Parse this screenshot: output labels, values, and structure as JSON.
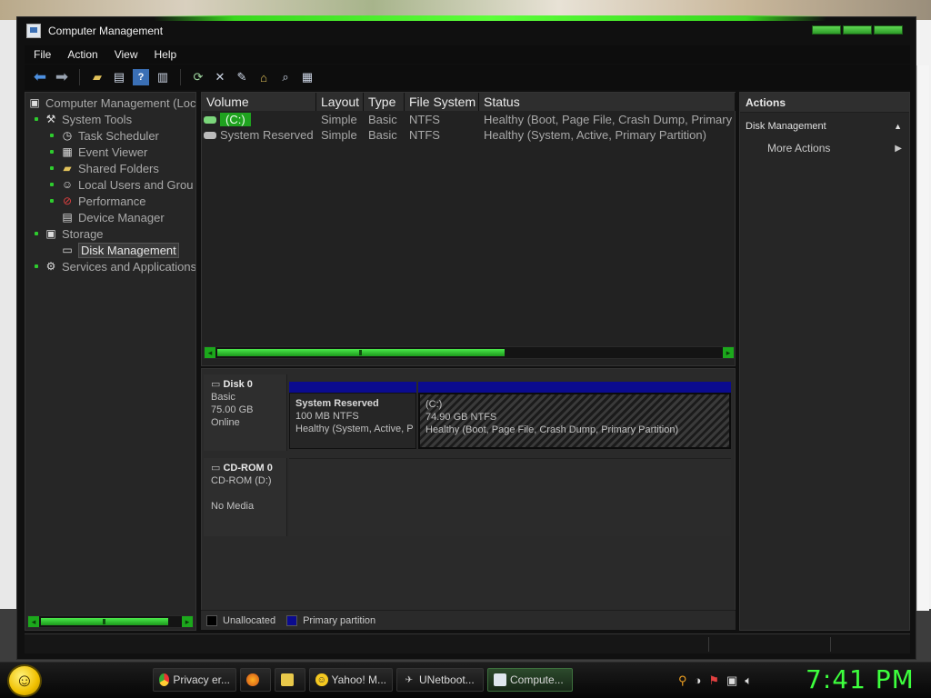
{
  "window": {
    "title": "Computer Management"
  },
  "menu": [
    "File",
    "Action",
    "View",
    "Help"
  ],
  "toolbar": [
    "back-icon",
    "forward-icon",
    "folder-up-icon",
    "properties-icon",
    "help-icon",
    "console-tree-icon",
    "refresh-icon",
    "delete-icon",
    "edit-icon",
    "open-icon",
    "search-icon",
    "settings-icon"
  ],
  "tree": {
    "root": "Computer Management (Loc",
    "system_tools": "System Tools",
    "task_scheduler": "Task Scheduler",
    "event_viewer": "Event Viewer",
    "shared_folders": "Shared Folders",
    "local_users": "Local Users and Grou",
    "performance": "Performance",
    "device_manager": "Device Manager",
    "storage": "Storage",
    "disk_management": "Disk Management",
    "services": "Services and Applications"
  },
  "volumes": {
    "headers": [
      "Volume",
      "Layout",
      "Type",
      "File System",
      "Status"
    ],
    "rows": [
      {
        "volume": "(C:)",
        "layout": "Simple",
        "type": "Basic",
        "fs": "NTFS",
        "status": "Healthy (Boot, Page File, Crash Dump, Primary"
      },
      {
        "volume": "System Reserved",
        "layout": "Simple",
        "type": "Basic",
        "fs": "NTFS",
        "status": "Healthy (System, Active, Primary Partition)"
      }
    ]
  },
  "disks": {
    "disk0": {
      "name": "Disk 0",
      "type": "Basic",
      "size": "75.00 GB",
      "state": "Online"
    },
    "cdrom0": {
      "name": "CD-ROM 0",
      "type": "CD-ROM (D:)",
      "state": "No Media"
    },
    "partitions": [
      {
        "name": "System Reserved",
        "size": "100 MB NTFS",
        "status": "Healthy (System, Active, P"
      },
      {
        "name": "(C:)",
        "size": "74.90 GB NTFS",
        "status": "Healthy (Boot, Page File, Crash Dump, Primary Partition)"
      }
    ]
  },
  "legend": {
    "unallocated": "Unallocated",
    "primary": "Primary partition",
    "unallocated_color": "#000000",
    "primary_color": "#0b0b8f"
  },
  "actions": {
    "header": "Actions",
    "section": "Disk Management",
    "more": "More Actions"
  },
  "taskbar": {
    "tasks": [
      {
        "label": "Privacy er...",
        "icon": "chrome-icon"
      },
      {
        "label": "",
        "icon": "firefox-icon"
      },
      {
        "label": "",
        "icon": "folder-icon"
      },
      {
        "label": "Yahoo! M...",
        "icon": "yahoo-messenger-icon"
      },
      {
        "label": "UNetboot...",
        "icon": "unetbootin-icon"
      },
      {
        "label": "Compute...",
        "icon": "computer-management-icon"
      }
    ],
    "clock": "7:41 PM"
  },
  "colors": {
    "accent": "#2ecc2e",
    "clock": "#3dff3d",
    "partition_bar": "#0b0b8f"
  }
}
